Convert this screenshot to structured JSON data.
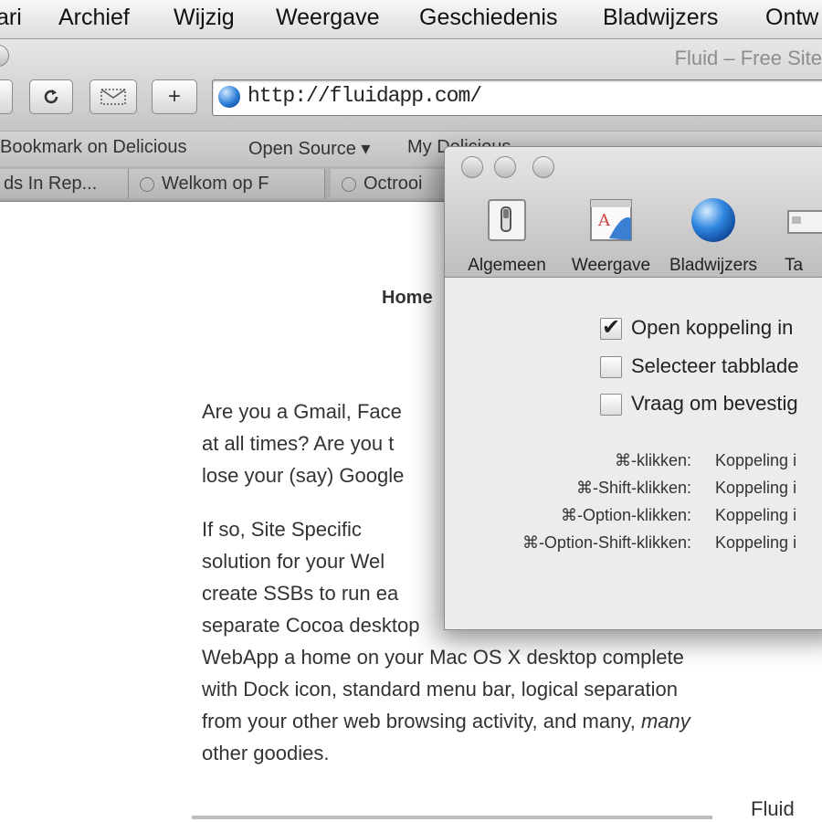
{
  "menubar": {
    "items": [
      "ari",
      "Archief",
      "Wijzig",
      "Weergave",
      "Geschiedenis",
      "Bladwijzers",
      "Ontw"
    ]
  },
  "window": {
    "title": "Fluid – Free Site"
  },
  "toolbar": {
    "reload_icon": "reload-icon",
    "mail_icon": "mail-icon",
    "add_label": "+",
    "url": "http://fluidapp.com/"
  },
  "bookmarks": {
    "items": [
      "Bookmark on Delicious",
      "Open Source ▾",
      "My Delicious"
    ]
  },
  "tabs": {
    "items": [
      "ds In Rep...",
      "Welkom op F",
      "Octrooi"
    ]
  },
  "page": {
    "nav_home": "Home",
    "para1_lines": [
      "Are you a Gmail, Face",
      "at all times? Are you t",
      "lose your (say) Google"
    ],
    "para2_lines": [
      "If so, Site Specific",
      "solution for your Wel",
      "create SSBs to run ea",
      "separate Cocoa desktop",
      "WebApp a home on your Mac OS X desktop complete",
      "with Dock icon, standard menu bar, logical separation",
      "from your other web browsing activity, and many,",
      "many",
      "other goodies."
    ],
    "footer": "Fluid"
  },
  "prefs": {
    "tabs": [
      {
        "label": "Algemeen",
        "icon": "switch-icon"
      },
      {
        "label": "Weergave",
        "icon": "appearance-icon"
      },
      {
        "label": "Bladwijzers",
        "icon": "globe-icon"
      },
      {
        "label": "Ta",
        "icon": "tabs-icon"
      }
    ],
    "checkboxes": [
      {
        "label": "Open koppeling in",
        "checked": true
      },
      {
        "label": "Selecteer tabblade",
        "checked": false
      },
      {
        "label": "Vraag om bevestig",
        "checked": false
      }
    ],
    "shortcuts": [
      {
        "key": "⌘-klikken:",
        "action": "Koppeling i"
      },
      {
        "key": "⌘-Shift-klikken:",
        "action": "Koppeling i"
      },
      {
        "key": "⌘-Option-klikken:",
        "action": "Koppeling i"
      },
      {
        "key": "⌘-Option-Shift-klikken:",
        "action": "Koppeling i"
      }
    ]
  },
  "colors": {
    "accent_blue": "#2b7cd6",
    "chrome_gray": "#c5c5c5"
  }
}
